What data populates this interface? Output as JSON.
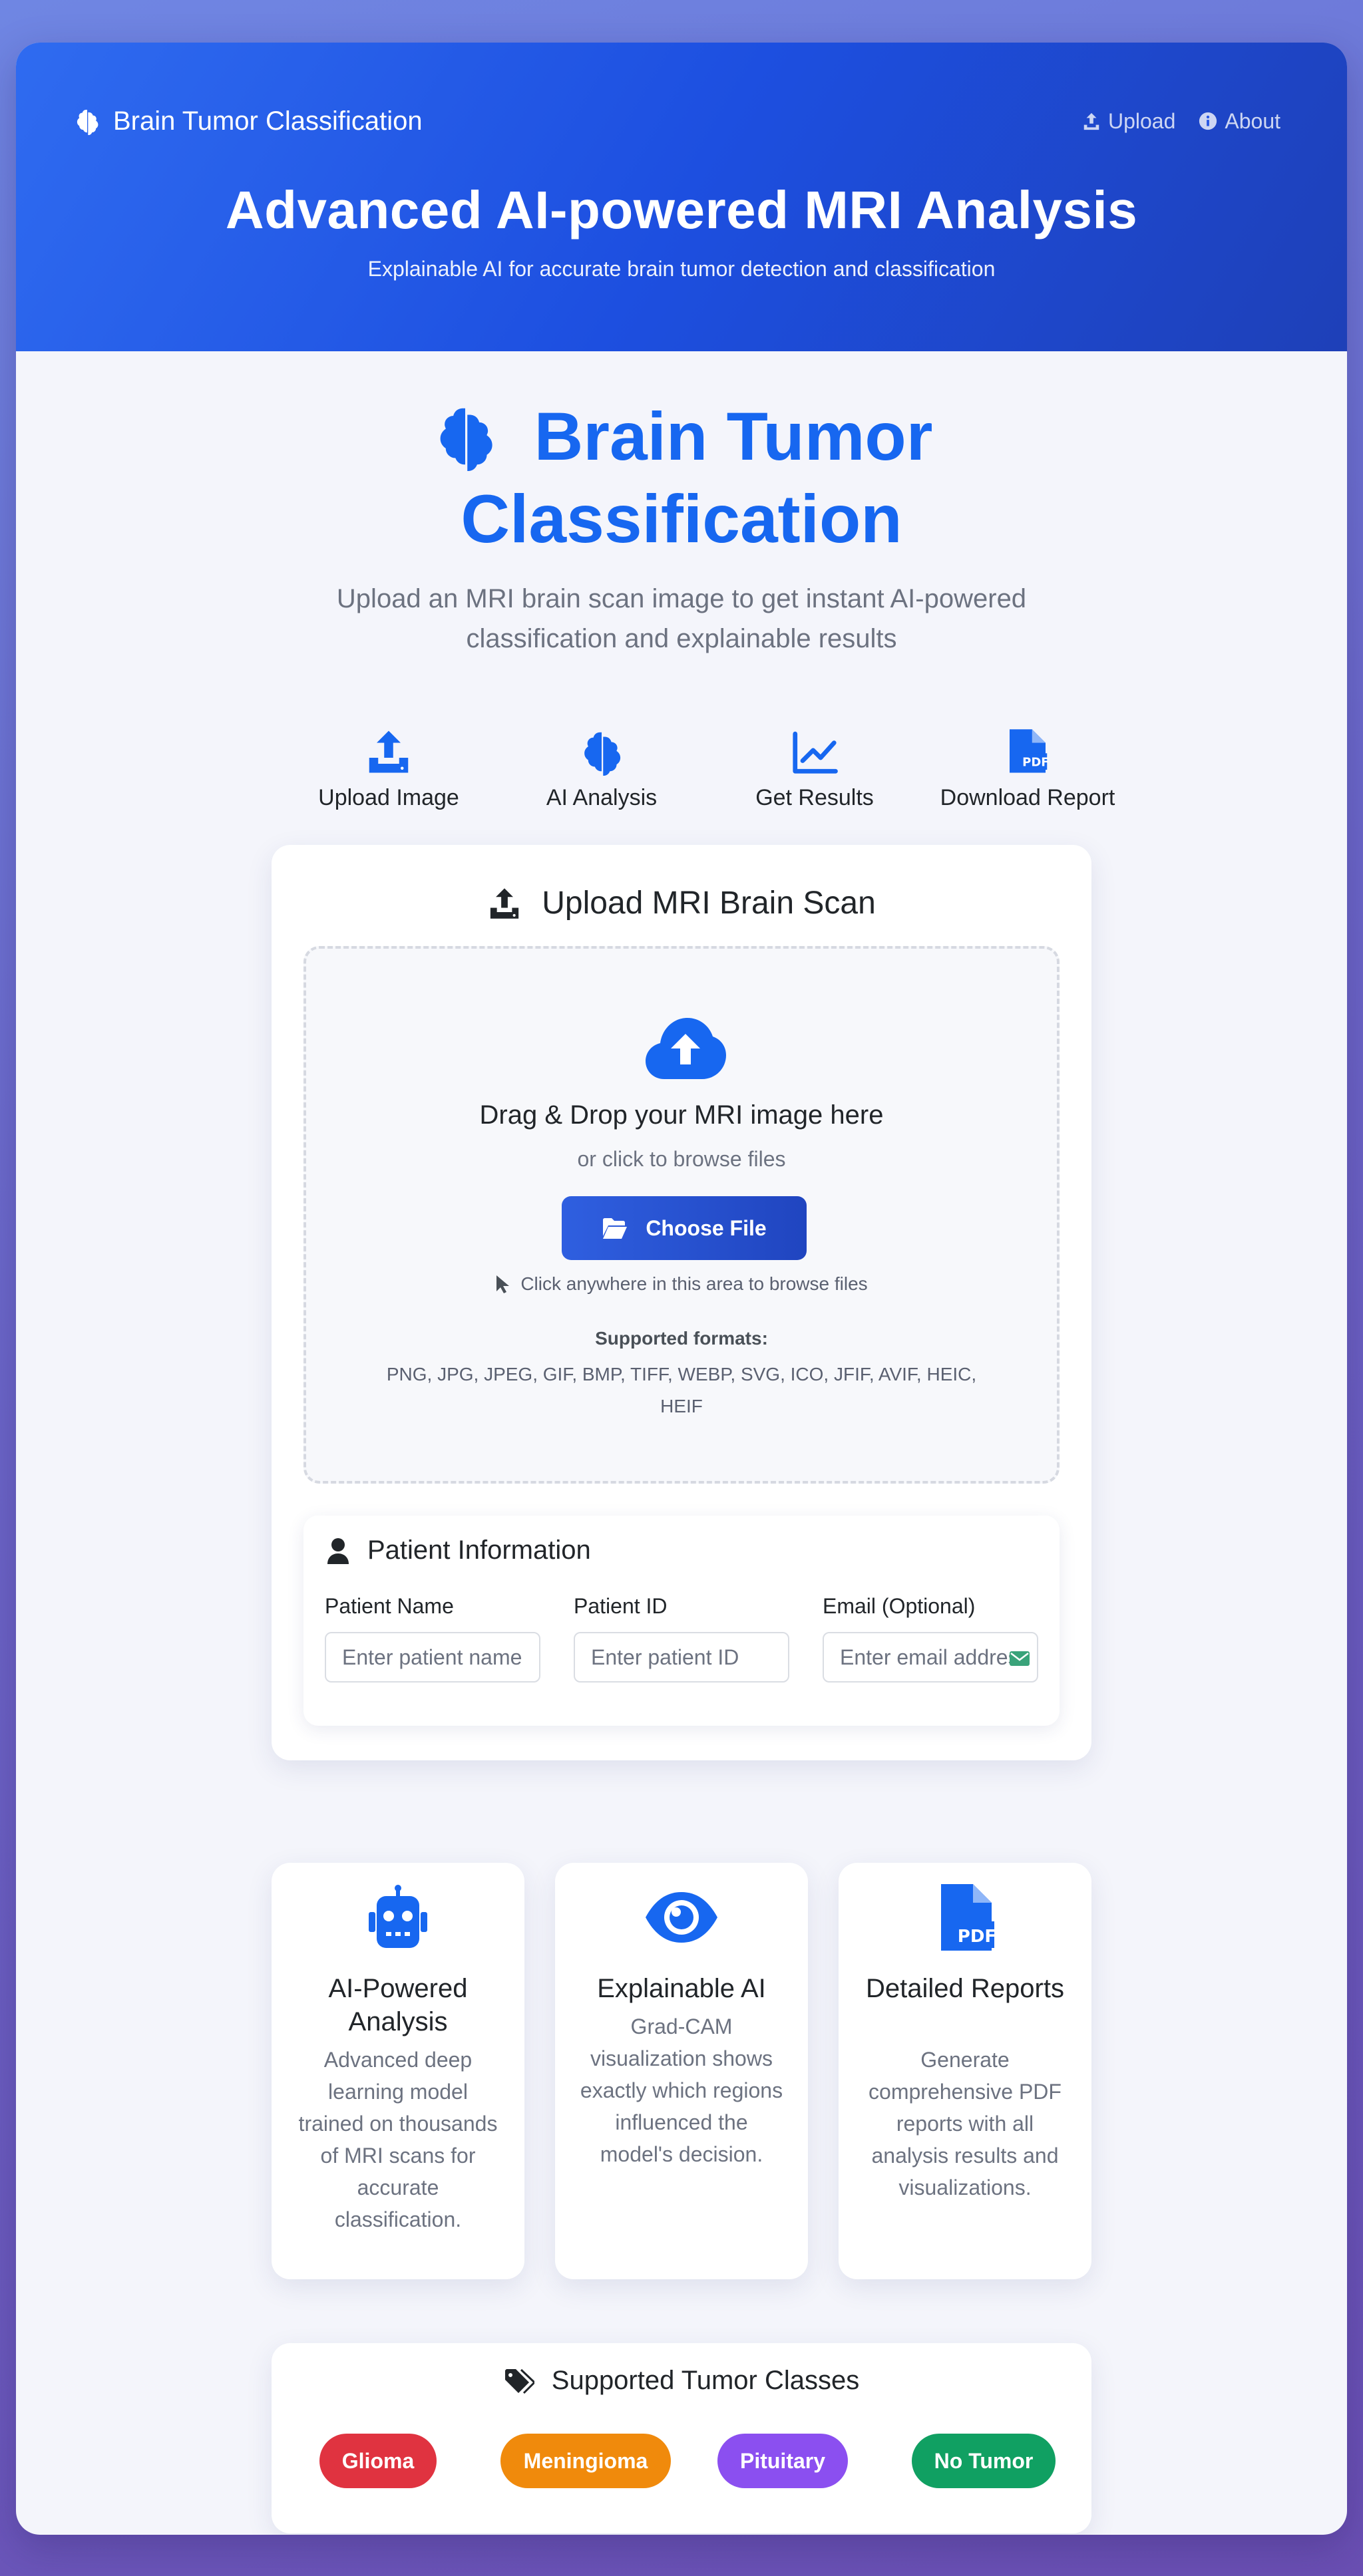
{
  "header": {
    "brand": "Brain Tumor Classification",
    "nav": [
      {
        "label": "Upload",
        "icon": "upload-icon"
      },
      {
        "label": "About",
        "icon": "info-icon"
      }
    ],
    "hero_title": "Advanced AI-powered MRI Analysis",
    "hero_subtitle": "Explainable AI for accurate brain tumor detection and classification"
  },
  "main": {
    "title_line1": "Brain Tumor",
    "title_line2": "Classification",
    "subtitle": "Upload an MRI brain scan image to get instant AI-powered classification and explainable results",
    "steps": [
      {
        "label": "Upload Image",
        "icon": "upload-icon"
      },
      {
        "label": "AI Analysis",
        "icon": "brain-icon"
      },
      {
        "label": "Get Results",
        "icon": "chart-line-icon"
      },
      {
        "label": "Download Report",
        "icon": "pdf-file-icon"
      }
    ]
  },
  "upload": {
    "title": "Upload MRI Brain Scan",
    "drop_title": "Drag & Drop your MRI image here",
    "drop_sub": "or click to browse files",
    "button": "Choose File",
    "hint": "Click anywhere in this area to browse files",
    "formats_label": "Supported formats:",
    "formats": "PNG, JPG, JPEG, GIF, BMP, TIFF, WEBP, SVG, ICO, JFIF, AVIF, HEIC, HEIF"
  },
  "patient": {
    "title": "Patient Information",
    "fields": [
      {
        "label": "Patient Name",
        "placeholder": "Enter patient name"
      },
      {
        "label": "Patient ID",
        "placeholder": "Enter patient ID"
      },
      {
        "label": "Email (Optional)",
        "placeholder": "Enter email address"
      }
    ]
  },
  "features": [
    {
      "title": "AI-Powered Analysis",
      "text": "Advanced deep learning model trained on thousands of MRI scans for accurate classification.",
      "icon": "robot-icon"
    },
    {
      "title": "Explainable AI",
      "text": "Grad-CAM visualization shows exactly which regions influenced the model's decision.",
      "icon": "eye-icon"
    },
    {
      "title": "Detailed Reports",
      "text": "Generate comprehensive PDF reports with all analysis results and visualizations.",
      "icon": "pdf-file-icon"
    }
  ],
  "classes": {
    "title": "Supported Tumor Classes",
    "items": [
      {
        "label": "Glioma",
        "color": "#e03340"
      },
      {
        "label": "Meningioma",
        "color": "#f08a0c"
      },
      {
        "label": "Pituitary",
        "color": "#8b4ff0"
      },
      {
        "label": "No Tumor",
        "color": "#10a062"
      }
    ]
  },
  "colors": {
    "accent": "#1767f0",
    "primary_button": "#2a52d0"
  }
}
